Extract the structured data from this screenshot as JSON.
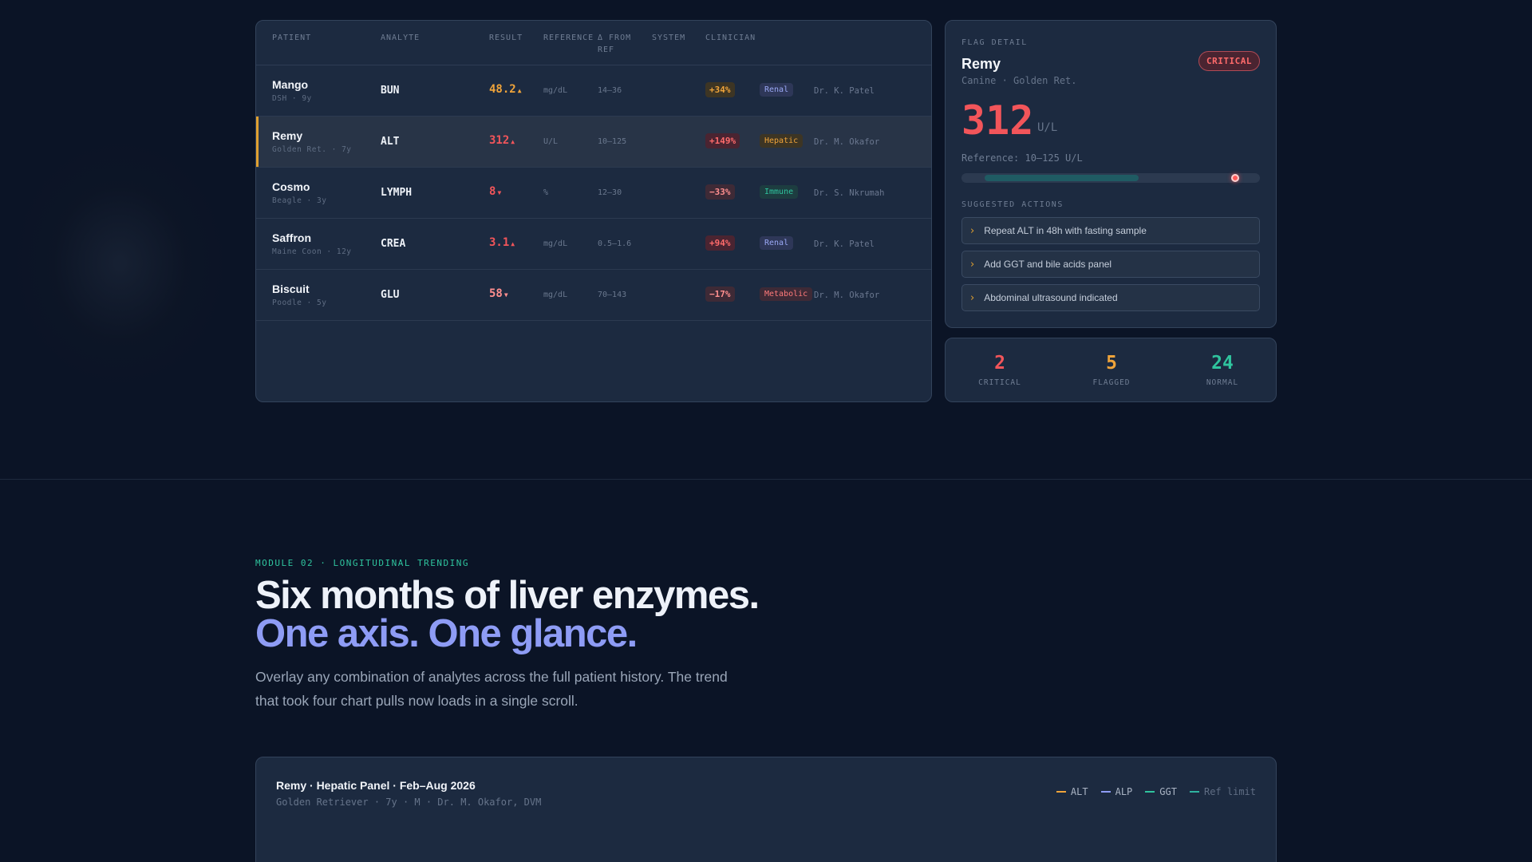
{
  "table": {
    "headers": {
      "patient": "PATIENT",
      "analyte": "ANALYTE",
      "result": "RESULT",
      "reference": "REFERENCE",
      "delta_line1": "Δ FROM",
      "delta_line2": "REF",
      "system": "SYSTEM",
      "clinician": "CLINICIAN"
    },
    "rows": [
      {
        "name": "Mango",
        "sub": "DSH · 9y",
        "analyte": "BUN",
        "result": "48.2",
        "arrow": "▲",
        "result_color": "#f0a43a",
        "unit": "mg/dL",
        "ref": "14–36",
        "delta": "+34%",
        "delta_color": "#f0a43a",
        "delta_bg": "#3d3524",
        "system": "Renal",
        "system_color": "#9aa8f5",
        "system_bg": "#2e3758",
        "clinician": "Dr. K. Patel"
      },
      {
        "name": "Remy",
        "sub": "Golden Ret. · 7y",
        "analyte": "ALT",
        "result": "312",
        "arrow": "▲",
        "result_color": "#f2555a",
        "unit": "U/L",
        "ref": "10–125",
        "delta": "+149%",
        "delta_color": "#ff6b6b",
        "delta_bg": "#4a2431",
        "system": "Hepatic",
        "system_color": "#f0a43a",
        "system_bg": "#3d3524",
        "clinician": "Dr. M. Okafor"
      },
      {
        "name": "Cosmo",
        "sub": "Beagle · 3y",
        "analyte": "LYMPH",
        "result": "8",
        "arrow": "▼",
        "result_color": "#f2555a",
        "unit": "%",
        "ref": "12–30",
        "delta": "−33%",
        "delta_color": "#ff8f8f",
        "delta_bg": "#3e2a36",
        "system": "Immune",
        "system_color": "#2fc49e",
        "system_bg": "#1d3d40",
        "clinician": "Dr. S. Nkrumah"
      },
      {
        "name": "Saffron",
        "sub": "Maine Coon · 12y",
        "analyte": "CREA",
        "result": "3.1",
        "arrow": "▲",
        "result_color": "#f2555a",
        "unit": "mg/dL",
        "ref": "0.5–1.6",
        "delta": "+94%",
        "delta_color": "#ff6b6b",
        "delta_bg": "#4a2431",
        "system": "Renal",
        "system_color": "#9aa8f5",
        "system_bg": "#2e3758",
        "clinician": "Dr. K. Patel"
      },
      {
        "name": "Biscuit",
        "sub": "Poodle · 5y",
        "analyte": "GLU",
        "result": "58",
        "arrow": "▼",
        "result_color": "#ff8f8f",
        "unit": "mg/dL",
        "ref": "70–143",
        "delta": "−17%",
        "delta_color": "#ff8f8f",
        "delta_bg": "#3e2a36",
        "system": "Metabolic",
        "system_color": "#ff7a7a",
        "system_bg": "#3e2a36",
        "clinician": "Dr. M. Okafor"
      }
    ]
  },
  "flag": {
    "label": "FLAG DETAIL",
    "name": "Remy",
    "sub": "Canine · Golden Ret.",
    "badge": "CRITICAL",
    "value": "312",
    "unit": "U/L",
    "reference": "Reference: 10–125 U/L",
    "range": {
      "min": 0,
      "max": 350,
      "ref_low": 10,
      "ref_high": 125,
      "value": 312
    },
    "actions_label": "SUGGESTED ACTIONS",
    "actions": [
      "Repeat ALT in 48h with fasting sample",
      "Add GGT and bile acids panel",
      "Abdominal ultrasound indicated"
    ]
  },
  "counts": [
    {
      "num": "2",
      "label": "CRITICAL",
      "color": "#f2555a"
    },
    {
      "num": "5",
      "label": "FLAGGED",
      "color": "#f0a43a"
    },
    {
      "num": "24",
      "label": "NORMAL",
      "color": "#2fc49e"
    }
  ],
  "section2": {
    "eyebrow": "MODULE 02 · LONGITUDINAL TRENDING",
    "headline_line1": "Six months of liver enzymes.",
    "headline_line2": "One axis. One glance.",
    "lede": "Overlay any combination of analytes across the full patient history. The trend that took four chart pulls now loads in a single scroll."
  },
  "chart": {
    "title": "Remy · Hepatic Panel · Feb–Aug 2026",
    "sub": "Golden Retriever · 7y · M · Dr. M. Okafor, DVM",
    "legend": [
      {
        "label": "ALT",
        "color": "#f0a43a",
        "style": "solid"
      },
      {
        "label": "ALP",
        "color": "#8e9cf5",
        "style": "solid"
      },
      {
        "label": "GGT",
        "color": "#2fc49e",
        "style": "solid"
      },
      {
        "label": "Ref limit",
        "color": "#2fb3a0",
        "style": "dash"
      }
    ]
  },
  "colors": {
    "background": "#0b1426",
    "card": "#1c2a40",
    "accent_amber": "#e0a030",
    "critical": "#f2555a",
    "normal": "#2fc49e",
    "indigo": "#8e9cf5"
  }
}
